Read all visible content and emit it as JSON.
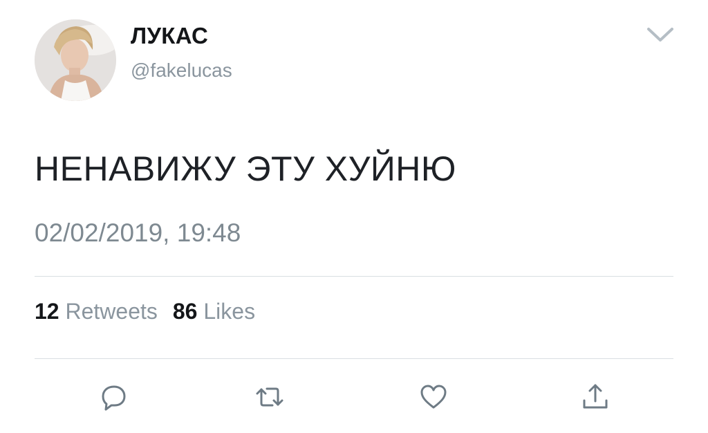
{
  "user": {
    "display_name": "ЛУКАС",
    "handle": "@fakelucas"
  },
  "tweet": {
    "text": "НЕНАВИЖУ ЭТУ ХУЙНЮ",
    "timestamp": "02/02/2019, 19:48"
  },
  "stats": {
    "retweets_count": "12",
    "retweets_label": "Retweets",
    "likes_count": "86",
    "likes_label": "Likes"
  },
  "icons": {
    "menu": "chevron-down-icon",
    "reply": "reply-icon",
    "retweet": "retweet-icon",
    "like": "heart-icon",
    "share": "share-icon"
  },
  "colors": {
    "text_primary": "#141619",
    "text_secondary": "#8a959e",
    "divider": "#d9dee2",
    "icon": "#6e7b85"
  }
}
